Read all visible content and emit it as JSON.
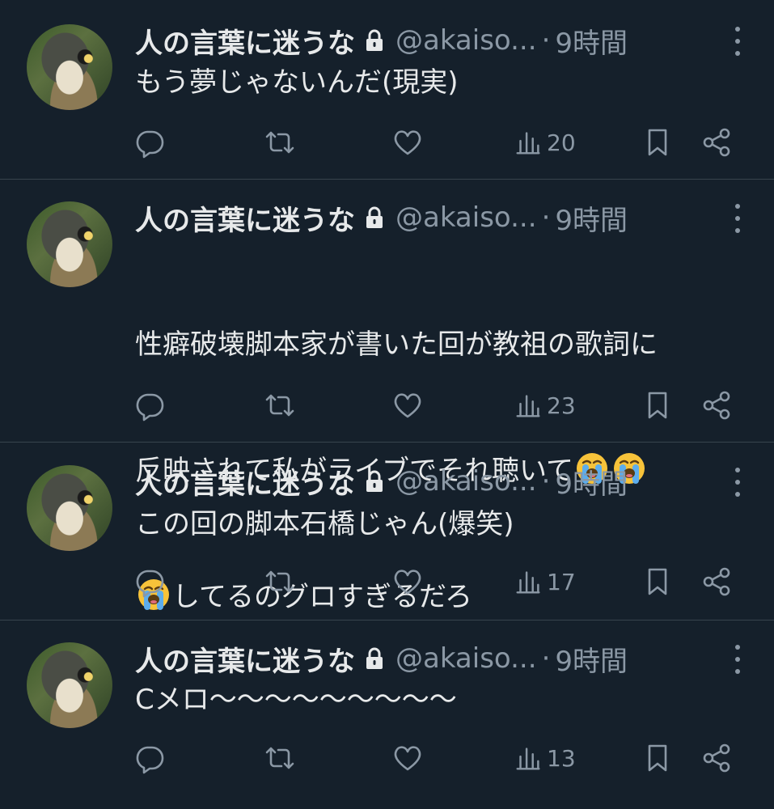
{
  "tweets": [
    {
      "author": "人の言葉に迷うな",
      "handle": "@akaiso...",
      "separator": "·",
      "time": "9時間",
      "text": "もう夢じゃないんだ(現実)",
      "views": "20"
    },
    {
      "author": "人の言葉に迷うな",
      "handle": "@akaiso...",
      "separator": "·",
      "time": "9時間",
      "text_line1": "性癖破壊脚本家が書いた回が教祖の歌詞に",
      "text_line2": "反映されて私がライブでそれ聴いて",
      "text_line3": "してるのグロすぎるだろ",
      "emoji": "loudly-crying-face",
      "views": "23"
    },
    {
      "author": "人の言葉に迷うな",
      "handle": "@akaiso...",
      "separator": "·",
      "time": "9時間",
      "text": "この回の脚本石橋じゃん(爆笑)",
      "views": "17"
    },
    {
      "author": "人の言葉に迷うな",
      "handle": "@akaiso...",
      "separator": "·",
      "time": "9時間",
      "text": "Cメロ〜〜〜〜〜〜〜〜〜",
      "views": "13"
    }
  ],
  "colors": {
    "background": "#15202b",
    "text": "#e7e9ea",
    "secondary": "#8b98a5",
    "divider": "#38444d"
  }
}
